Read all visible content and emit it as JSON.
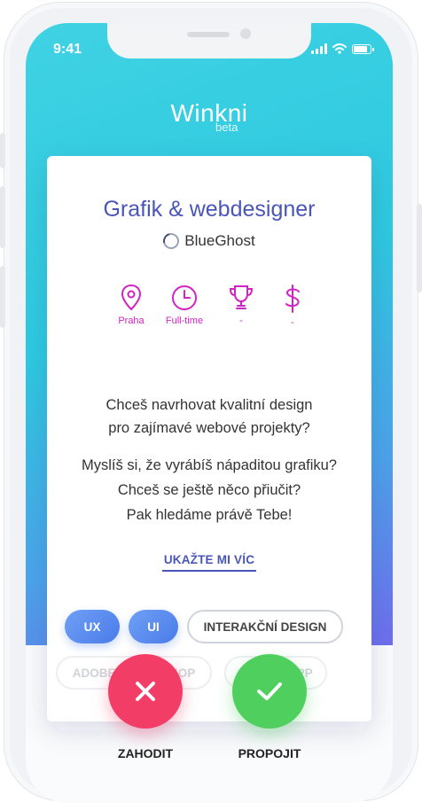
{
  "status_bar": {
    "time": "9:41"
  },
  "brand": {
    "name": "Winkni",
    "tag": "beta"
  },
  "job": {
    "title": "Grafik & webdesigner",
    "company": "BlueGhost",
    "facts": [
      {
        "icon": "location-pin-icon",
        "label": "Praha"
      },
      {
        "icon": "clock-icon",
        "label": "Full-time"
      },
      {
        "icon": "trophy-icon",
        "label": "-"
      },
      {
        "icon": "dollar-icon",
        "label": "-"
      }
    ],
    "description": {
      "line1": "Chceš navrhovat kvalitní design",
      "line2": "pro zajímavé webové projekty?",
      "line3": "Myslíš si, že vyrábíš nápaditou grafiku?",
      "line4": "Chceš se ještě něco přiučit?",
      "line5": "Pak hledáme právě Tebe!"
    },
    "more_label": "UKAŽTE MI VÍC",
    "tags": [
      "UX",
      "UI",
      "INTERAKČNÍ DESIGN",
      "ADOBE PHOTOSHOP",
      "SKETCHAPP"
    ]
  },
  "actions": {
    "reject_label": "ZAHODIT",
    "accept_label": "PROPOJIT"
  },
  "colors": {
    "accent": "#4a55b8",
    "icon_magenta": "#d224c3",
    "reject": "#f23d67",
    "accept": "#4fd05e"
  }
}
